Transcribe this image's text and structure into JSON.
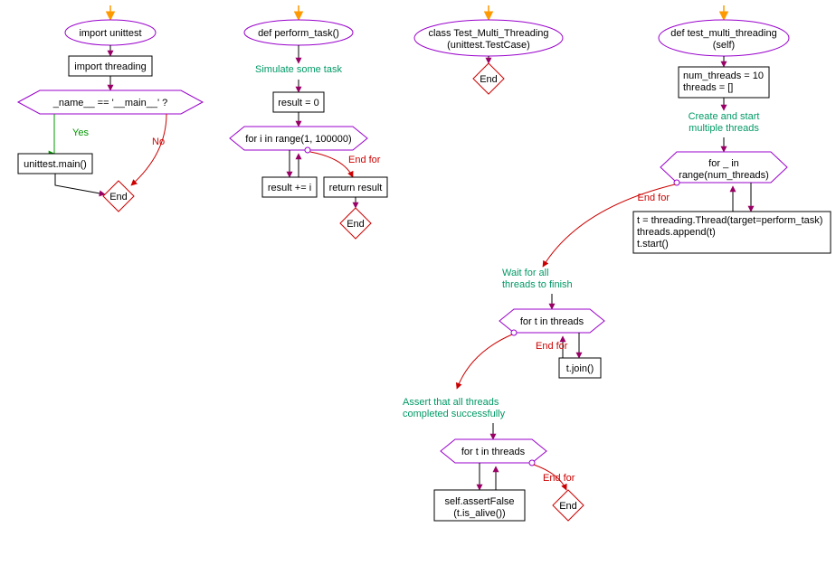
{
  "chart_data": {
    "type": "flowchart",
    "flows": [
      {
        "id": "flow-main",
        "nodes": [
          {
            "id": "main_start",
            "type": "start"
          },
          {
            "id": "main_import_unittest",
            "type": "terminal",
            "text": "import unittest"
          },
          {
            "id": "main_import_threading",
            "type": "process",
            "text": "import threading"
          },
          {
            "id": "main_if",
            "type": "decision",
            "text": "_name__ == '__main__' ?"
          },
          {
            "id": "main_call",
            "type": "process",
            "text": "unittest.main()"
          },
          {
            "id": "main_end",
            "type": "end",
            "text": "End"
          }
        ],
        "edges": [
          {
            "from": "main_start",
            "to": "main_import_unittest"
          },
          {
            "from": "main_import_unittest",
            "to": "main_import_threading"
          },
          {
            "from": "main_import_threading",
            "to": "main_if"
          },
          {
            "from": "main_if",
            "to": "main_call",
            "label": "Yes"
          },
          {
            "from": "main_if",
            "to": "main_end",
            "label": "No"
          },
          {
            "from": "main_call",
            "to": "main_end"
          }
        ]
      },
      {
        "id": "flow-perform-task",
        "nodes": [
          {
            "id": "pt_start",
            "type": "start"
          },
          {
            "id": "pt_def",
            "type": "terminal",
            "text": "def perform_task()"
          },
          {
            "id": "pt_comment",
            "type": "comment",
            "text": "Simulate some task"
          },
          {
            "id": "pt_result0",
            "type": "process",
            "text": "result = 0"
          },
          {
            "id": "pt_for",
            "type": "loop",
            "text": "for i in range(1, 100000)"
          },
          {
            "id": "pt_body",
            "type": "process",
            "text": "result += i"
          },
          {
            "id": "pt_return",
            "type": "process",
            "text": "return result",
            "loopExit": true,
            "exitLabel": "End for"
          },
          {
            "id": "pt_end",
            "type": "end",
            "text": "End"
          }
        ]
      },
      {
        "id": "flow-class",
        "nodes": [
          {
            "id": "cls_start",
            "type": "start"
          },
          {
            "id": "cls_def",
            "type": "terminal",
            "text": "class Test_Multi_Threading\n(unittest.TestCase)"
          },
          {
            "id": "cls_end",
            "type": "end",
            "text": "End"
          }
        ]
      },
      {
        "id": "flow-test-method",
        "nodes": [
          {
            "id": "tm_start",
            "type": "start"
          },
          {
            "id": "tm_def",
            "type": "terminal",
            "text": "def test_multi_threading\n(self)"
          },
          {
            "id": "tm_init",
            "type": "process",
            "text": "num_threads = 10\nthreads = []"
          },
          {
            "id": "tm_c1",
            "type": "comment",
            "text": "Create and start\nmultiple threads"
          },
          {
            "id": "tm_for1",
            "type": "loop",
            "text": "for _ in\nrange(num_threads)"
          },
          {
            "id": "tm_body1",
            "type": "process",
            "text": "t = threading.Thread(target=perform_task)\nthreads.append(t)\nt.start()"
          },
          {
            "id": "tm_c2",
            "type": "comment",
            "text": "Wait for all\nthreads to finish",
            "loopExit": true,
            "exitLabel": "End for"
          },
          {
            "id": "tm_for2",
            "type": "loop",
            "text": "for t in threads"
          },
          {
            "id": "tm_body2",
            "type": "process",
            "text": "t.join()"
          },
          {
            "id": "tm_c3",
            "type": "comment",
            "text": "Assert that all threads\ncompleted successfully",
            "loopExit": true,
            "exitLabel": "End for"
          },
          {
            "id": "tm_for3",
            "type": "loop",
            "text": "for t in threads"
          },
          {
            "id": "tm_body3",
            "type": "process",
            "text": "self.assertFalse\n(t.is_alive())"
          },
          {
            "id": "tm_end",
            "type": "end",
            "text": "End",
            "loopExit": true,
            "exitLabel": "End for"
          }
        ]
      }
    ]
  },
  "labels": {
    "yes": "Yes",
    "no": "No",
    "end": "End",
    "end_for": "End for"
  },
  "colors": {
    "start_arrow": "#ff9900",
    "terminal_stroke": "#9900cc",
    "process_stroke": "#000000",
    "decision_stroke": "#9900cc",
    "loop_stroke": "#9900cc",
    "end_stroke": "#cc0000",
    "comment_text": "#009966",
    "yes_edge": "#009900",
    "no_edge": "#cc0000",
    "exit_edge": "#cc0000",
    "normal_edge": "#000000",
    "arrow_fill": "#990066"
  }
}
